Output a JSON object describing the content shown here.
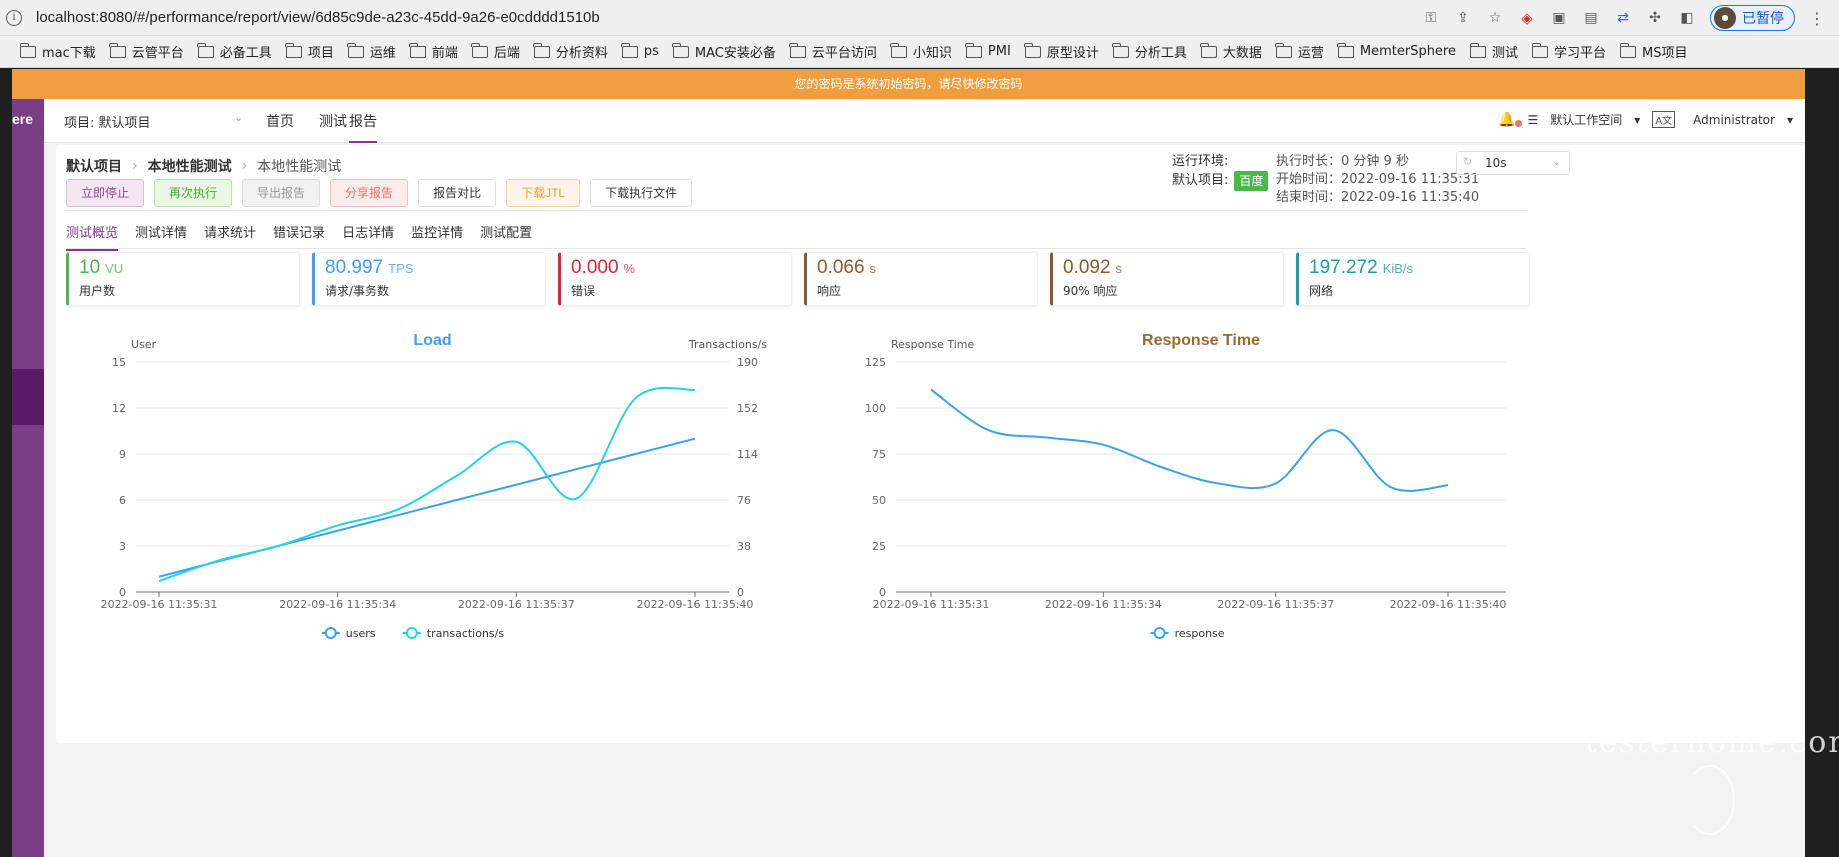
{
  "browser": {
    "url": "localhost:8080/#/performance/report/view/6d85c9de-a23c-45dd-9a26-e0cdddd1510b",
    "profile_label": "已暂停",
    "bookmarks": [
      "mac下载",
      "云管平台",
      "必备工具",
      "项目",
      "运维",
      "前端",
      "后端",
      "分析资料",
      "ps",
      "MAC安装必备",
      "云平台访问",
      "小知识",
      "PMI",
      "原型设计",
      "分析工具",
      "大数据",
      "运营",
      "MemterSphere",
      "测试",
      "学习平台",
      "MS项目"
    ]
  },
  "notice": "您的密码是系统初始密码，请尽快修改密码",
  "sidebar": {
    "logo_text": "ere"
  },
  "topnav": {
    "project": "项目: 默认项目",
    "items": [
      "首页",
      "测试",
      "报告"
    ],
    "active": "报告",
    "workspace": "默认工作空间",
    "user": "Administrator"
  },
  "breadcrumb": [
    "默认项目",
    "本地性能测试",
    "本地性能测试"
  ],
  "actions": [
    "立即停止",
    "再次执行",
    "导出报告",
    "分享报告",
    "报告对比",
    "下载JTL",
    "下载执行文件"
  ],
  "env": {
    "label": "运行环境:",
    "project_label": "默认项目:",
    "tag": "百度"
  },
  "timing": {
    "duration_label": "执行时长：",
    "duration": "0 分钟 9 秒",
    "start_label": "开始时间：",
    "start": "2022-09-16 11:35:31",
    "end_label": "结束时间：",
    "end": "2022-09-16 11:35:40"
  },
  "refresh_interval": "10s",
  "tabs": [
    "测试概览",
    "测试详情",
    "请求统计",
    "错误记录",
    "日志详情",
    "监控详情",
    "测试配置"
  ],
  "metrics": [
    {
      "value": "10",
      "unit": "VU",
      "label": "用户数",
      "color": "#49b84a"
    },
    {
      "value": "80.997",
      "unit": "TPS",
      "label": "请求/事务数",
      "color": "#409eff"
    },
    {
      "value": "0.000",
      "unit": "%",
      "label": "错误",
      "color": "#e61e3c"
    },
    {
      "value": "0.066",
      "unit": "s",
      "label": "响应",
      "color": "#8b5a2b"
    },
    {
      "value": "0.092",
      "unit": "s",
      "label": "90% 响应",
      "color": "#8b5a2b"
    },
    {
      "value": "197.272",
      "unit": "KiB/s",
      "label": "网络",
      "color": "#1aa0a0"
    }
  ],
  "chart_data": [
    {
      "type": "line",
      "title": "Load",
      "title_color": "#409eff",
      "ylabel": "User",
      "y2label": "Transactions/s",
      "x": [
        "2022-09-16 11:35:31",
        "2022-09-16 11:35:32",
        "2022-09-16 11:35:33",
        "2022-09-16 11:35:34",
        "2022-09-16 11:35:35",
        "2022-09-16 11:35:36",
        "2022-09-16 11:35:37",
        "2022-09-16 11:35:38",
        "2022-09-16 11:35:39",
        "2022-09-16 11:35:40"
      ],
      "xticks": [
        "2022-09-16 11:35:31",
        "2022-09-16 11:35:34",
        "2022-09-16 11:35:37",
        "2022-09-16 11:35:40"
      ],
      "ylim": [
        0,
        15
      ],
      "yticks": [
        0,
        3,
        6,
        9,
        12,
        15
      ],
      "y2lim": [
        0,
        190
      ],
      "y2ticks": [
        0,
        38,
        76,
        114,
        152,
        190
      ],
      "series": [
        {
          "name": "users",
          "axis": "left",
          "color": "#3aa0f0",
          "values": [
            1,
            2,
            3,
            4,
            5,
            6,
            7,
            8,
            9,
            10
          ]
        },
        {
          "name": "transactions/s",
          "axis": "right",
          "color": "#22d3e6",
          "values": [
            9,
            26,
            38,
            55,
            68,
            96,
            124,
            77,
            160,
            167
          ]
        }
      ],
      "legend": "bottom"
    },
    {
      "type": "line",
      "title": "Response Time",
      "title_color": "#9a6a30",
      "ylabel": "Response Time",
      "x": [
        "2022-09-16 11:35:31",
        "2022-09-16 11:35:32",
        "2022-09-16 11:35:33",
        "2022-09-16 11:35:34",
        "2022-09-16 11:35:35",
        "2022-09-16 11:35:36",
        "2022-09-16 11:35:37",
        "2022-09-16 11:35:38",
        "2022-09-16 11:35:39",
        "2022-09-16 11:35:40"
      ],
      "xticks": [
        "2022-09-16 11:35:31",
        "2022-09-16 11:35:34",
        "2022-09-16 11:35:37",
        "2022-09-16 11:35:40"
      ],
      "ylim": [
        0,
        125
      ],
      "yticks": [
        0,
        25,
        50,
        75,
        100,
        125
      ],
      "series": [
        {
          "name": "response",
          "color": "#3aa0f0",
          "values": [
            110,
            88,
            84,
            80,
            68,
            59,
            59,
            88,
            57,
            58
          ]
        }
      ],
      "legend": "bottom"
    }
  ]
}
